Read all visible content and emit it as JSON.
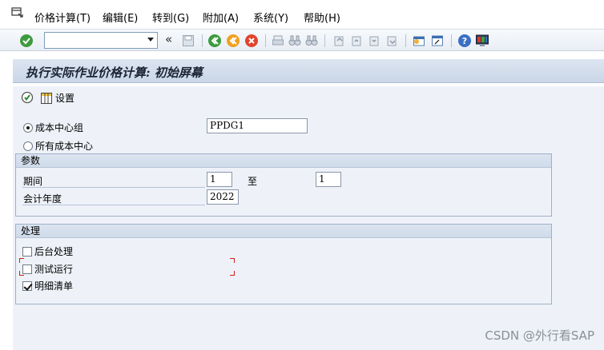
{
  "menubar": {
    "items": [
      {
        "label": "价格计算(T)"
      },
      {
        "label": "编辑(E)"
      },
      {
        "label": "转到(G)"
      },
      {
        "label": "附加(A)"
      },
      {
        "label": "系统(Y)"
      },
      {
        "label": "帮助(H)"
      }
    ]
  },
  "toolbar": {
    "command_field_value": "",
    "back_chevron": "«"
  },
  "title": "执行实际作业价格计算: 初始屏幕",
  "app_toolbar": {
    "settings_label": "设置"
  },
  "selection": {
    "cost_center_group_label": "成本中心组",
    "cost_center_group_value": "PPDG1",
    "all_cost_centers_label": "所有成本中心",
    "selected": "cost_center_group"
  },
  "parameters": {
    "heading": "参数",
    "period_label": "期间",
    "period_from": "1",
    "to_label": "至",
    "period_to": "1",
    "fiscal_year_label": "会计年度",
    "fiscal_year": "2022"
  },
  "processing": {
    "heading": "处理",
    "background_label": "后台处理",
    "background_checked": false,
    "test_run_label": "测试运行",
    "test_run_checked": false,
    "detail_list_label": "明细清单",
    "detail_list_checked": true
  },
  "watermark": "CSDN @外行看SAP",
  "colors": {
    "accent_green": "#2e8b2e",
    "brand_blue": "#3366cc",
    "focus_red": "#d0201a"
  }
}
